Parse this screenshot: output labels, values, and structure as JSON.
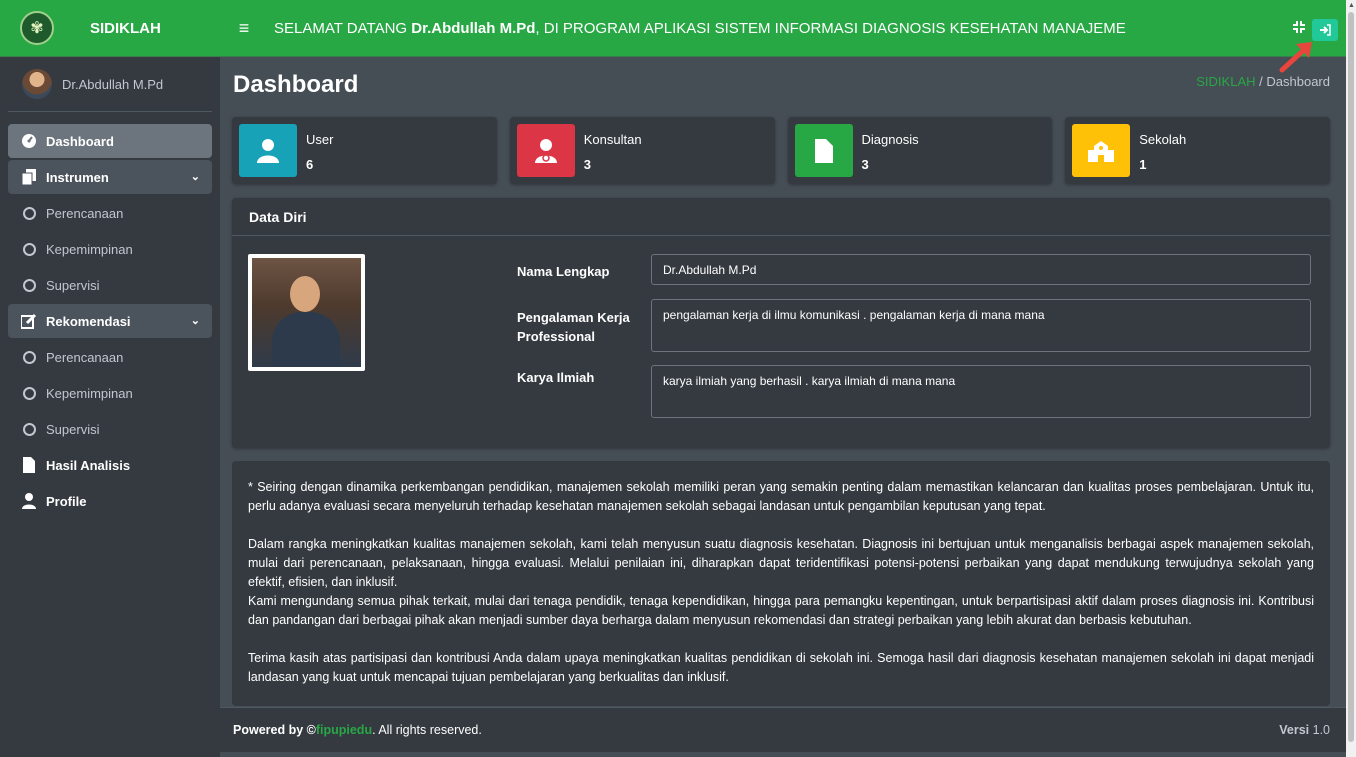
{
  "brand": {
    "name": "SIDIKLAH"
  },
  "user": {
    "name": "Dr.Abdullah M.Pd"
  },
  "sidebar": {
    "items": [
      {
        "label": "Dashboard"
      },
      {
        "label": "Instrumen"
      },
      {
        "label": "Perencanaan"
      },
      {
        "label": "Kepemimpinan"
      },
      {
        "label": "Supervisi"
      },
      {
        "label": "Rekomendasi"
      },
      {
        "label": "Perencanaan"
      },
      {
        "label": "Kepemimpinan"
      },
      {
        "label": "Supervisi"
      },
      {
        "label": "Hasil Analisis"
      },
      {
        "label": "Profile"
      }
    ]
  },
  "header": {
    "welcome_prefix": "SELAMAT DATANG ",
    "welcome_name": "Dr.Abdullah M.Pd",
    "welcome_suffix": ", DI PROGRAM APLIKASI SISTEM INFORMASI DIAGNOSIS KESEHATAN MANAJEMEN SEKOLAH"
  },
  "page": {
    "title": "Dashboard"
  },
  "breadcrumb": {
    "home": "SIDIKLAH",
    "sep": "/",
    "current": "Dashboard"
  },
  "cards": [
    {
      "label": "User",
      "value": "6",
      "color": "#17a2b8",
      "icon": "user-icon"
    },
    {
      "label": "Konsultan",
      "value": "3",
      "color": "#dc3545",
      "icon": "doctor-icon"
    },
    {
      "label": "Diagnosis",
      "value": "3",
      "color": "#28a745",
      "icon": "file-icon"
    },
    {
      "label": "Sekolah",
      "value": "1",
      "color": "#ffc107",
      "icon": "school-icon"
    }
  ],
  "data_diri": {
    "title": "Data Diri",
    "nama_label": "Nama Lengkap",
    "nama_value": "Dr.Abdullah M.Pd",
    "pengalaman_label_1": "Pengalaman Kerja",
    "pengalaman_label_2": "Professional",
    "pengalaman_value": "pengalaman kerja di ilmu komunikasi . pengalaman kerja di mana mana",
    "karya_label": "Karya Ilmiah",
    "karya_value": "karya ilmiah yang berhasil . karya ilmiah di mana mana"
  },
  "info": {
    "p1": "* Seiring dengan dinamika perkembangan pendidikan, manajemen sekolah memiliki peran yang semakin penting dalam memastikan kelancaran dan kualitas proses pembelajaran. Untuk itu, perlu adanya evaluasi secara menyeluruh terhadap kesehatan manajemen sekolah sebagai landasan untuk pengambilan keputusan yang tepat.",
    "p2": "Dalam rangka meningkatkan kualitas manajemen sekolah, kami telah menyusun suatu diagnosis kesehatan. Diagnosis ini bertujuan untuk menganalisis berbagai aspek manajemen sekolah, mulai dari perencanaan, pelaksanaan, hingga evaluasi. Melalui penilaian ini, diharapkan dapat teridentifikasi potensi-potensi perbaikan yang dapat mendukung terwujudnya sekolah yang efektif, efisien, dan inklusif.",
    "p3": "Kami mengundang semua pihak terkait, mulai dari tenaga pendidik, tenaga kependidikan, hingga para pemangku kepentingan, untuk berpartisipasi aktif dalam proses diagnosis ini. Kontribusi dan pandangan dari berbagai pihak akan menjadi sumber daya berharga dalam menyusun rekomendasi dan strategi perbaikan yang lebih akurat dan berbasis kebutuhan.",
    "p4": "Terima kasih atas partisipasi dan kontribusi Anda dalam upaya meningkatkan kualitas pendidikan di sekolah ini. Semoga hasil dari diagnosis kesehatan manajemen sekolah ini dapat menjadi landasan yang kuat untuk mencapai tujuan pembelajaran yang berkualitas dan inklusif."
  },
  "footer": {
    "powered": "Powered by © ",
    "brand": "fipupiedu",
    "rights": ". All rights reserved.",
    "version_label": "Versi",
    "version_value": " 1.0"
  }
}
